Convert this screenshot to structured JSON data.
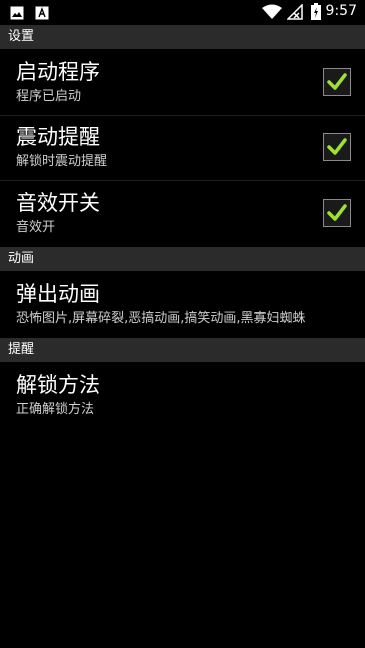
{
  "status_bar": {
    "time": "9:57",
    "icons": [
      "image-icon",
      "font-icon",
      "wifi-icon",
      "no-signal-icon",
      "battery-charging-icon"
    ]
  },
  "sections": {
    "settings": {
      "label": "设置"
    },
    "animation": {
      "label": "动画"
    },
    "reminder": {
      "label": "提醒"
    }
  },
  "prefs": {
    "launch": {
      "title": "启动程序",
      "summary": "程序已启动",
      "checked": true
    },
    "vibrate": {
      "title": "震动提醒",
      "summary": "解锁时震动提醒",
      "checked": true
    },
    "sound": {
      "title": "音效开关",
      "summary": "音效开",
      "checked": true
    },
    "popup": {
      "title": "弹出动画",
      "summary": "恐怖图片,屏幕碎裂,恶搞动画,搞笑动画,黑寡妇蜘蛛"
    },
    "unlock": {
      "title": "解锁方法",
      "summary": "正确解锁方法"
    }
  },
  "colors": {
    "check": "#9fe030",
    "header_bg": "#2b2b2b"
  }
}
